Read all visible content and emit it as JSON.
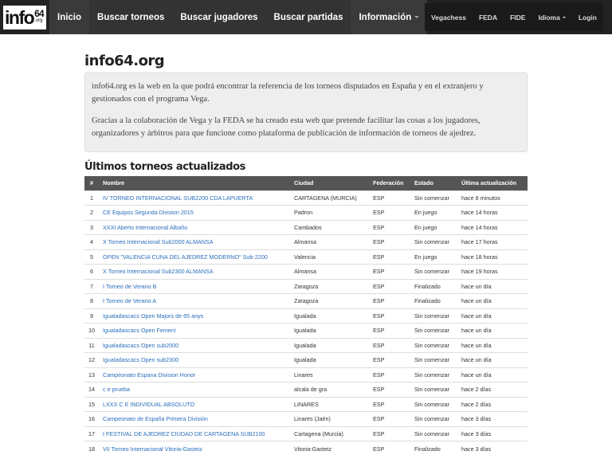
{
  "navbar": {
    "brand": {
      "main": "info",
      "num": "64",
      "sub": ".org"
    },
    "left_items": [
      {
        "label": "Inicio",
        "active": true
      },
      {
        "label": "Buscar torneos"
      },
      {
        "label": "Buscar jugadores"
      },
      {
        "label": "Buscar partidas"
      },
      {
        "label": "Información",
        "dropdown": true
      }
    ],
    "right_items": [
      {
        "label": "Vegachess"
      },
      {
        "label": "FEDA"
      },
      {
        "label": "FIDE"
      },
      {
        "label": "Idioma",
        "dropdown": true
      },
      {
        "label": "Login"
      }
    ]
  },
  "page": {
    "title": "info64.org",
    "intro": [
      "info64.org es la web en la que podrá encontrar la referencia de los torneos disputados en España y en el extranjero y gestionados con el programa Vega.",
      "Gracias a la colaboración de Vega y la FEDA se ha creado esta web que pretende facilitar las cosas a los jugadores, organizadores y árbitros para que funcione como plataforma de publicación de información de torneos de ajedrez."
    ],
    "section_title": "Últimos torneos actualizados"
  },
  "table": {
    "headers": [
      "#",
      "Nombre",
      "Ciudad",
      "Federación",
      "Estado",
      "Última actualización"
    ],
    "rows": [
      [
        "1",
        "IV TORNEO INTERNACIONAL SUB2200 CDA LAPUERTA",
        "CARTAGENA (MURCIA)",
        "ESP",
        "Sin comenzar",
        "hace 8 minutos"
      ],
      [
        "2",
        "CE Equipos Segunda Division 2015",
        "Padron",
        "ESP",
        "En juego",
        "hace 14 horas"
      ],
      [
        "3",
        "XXXI Aberto Internacional Albaño",
        "Cambados",
        "ESP",
        "En juego",
        "hace 14 horas"
      ],
      [
        "4",
        "X Torneo Internacional Sub2000 ALMANSA",
        "Almansa",
        "ESP",
        "Sin comenzar",
        "hace 17 horas"
      ],
      [
        "5",
        "OPEN \"VALENCIA CUNA DEL AJEDREZ MODERNO\" Sub-2200",
        "Valencia",
        "ESP",
        "En juego",
        "hace 18 horas"
      ],
      [
        "6",
        "X Torneo Internacional Sub2300 ALMANSA",
        "Almansa",
        "ESP",
        "Sin comenzar",
        "hace 19 horas"
      ],
      [
        "7",
        "I Torneo de Verano B",
        "Zaragoza",
        "ESP",
        "Finalizado",
        "hace un día"
      ],
      [
        "8",
        "I Torneo de Verano A",
        "Zaragoza",
        "ESP",
        "Finalizado",
        "hace un día"
      ],
      [
        "9",
        "Igualadascacs Open Majors de 65 anys",
        "Igualada",
        "ESP",
        "Sin comenzar",
        "hace un día"
      ],
      [
        "10",
        "Igualadascacs Open Femení",
        "Igualada",
        "ESP",
        "Sin comenzar",
        "hace un día"
      ],
      [
        "11",
        "Igualadascacs Open sub2000",
        "Igualada",
        "ESP",
        "Sin comenzar",
        "hace un día"
      ],
      [
        "12",
        "Igualadascacs Open sub2300",
        "Igualada",
        "ESP",
        "Sin comenzar",
        "hace un día"
      ],
      [
        "13",
        "Campeonato Espana Division Honor",
        "Linares",
        "ESP",
        "Sin comenzar",
        "hace un día"
      ],
      [
        "14",
        "c e prueba",
        "alcala de gra",
        "ESP",
        "Sin comenzar",
        "hace 2 días"
      ],
      [
        "15",
        "LXXX C E INDIVIDUAL ABSOLUTO",
        "LINARES",
        "ESP",
        "Sin comenzar",
        "hace 2 días"
      ],
      [
        "16",
        "Campeonato de España Primera División",
        "Linares (Jaén)",
        "ESP",
        "Sin comenzar",
        "hace 3 días"
      ],
      [
        "17",
        "I FESTIVAL DE AJEDREZ CIUDAD DE CARTAGENA SUB2100",
        "Cartagena (Murcia)",
        "ESP",
        "Sin comenzar",
        "hace 3 días"
      ],
      [
        "18",
        "VII Torneo Internacional Vitoria-Gasteiz",
        "Vitoria-Gasteiz",
        "ESP",
        "Finalizado",
        "hace 3 días"
      ]
    ]
  },
  "colors": {
    "navbar": "#222222",
    "link": "#2a6ebb",
    "table_header": "#555555"
  }
}
